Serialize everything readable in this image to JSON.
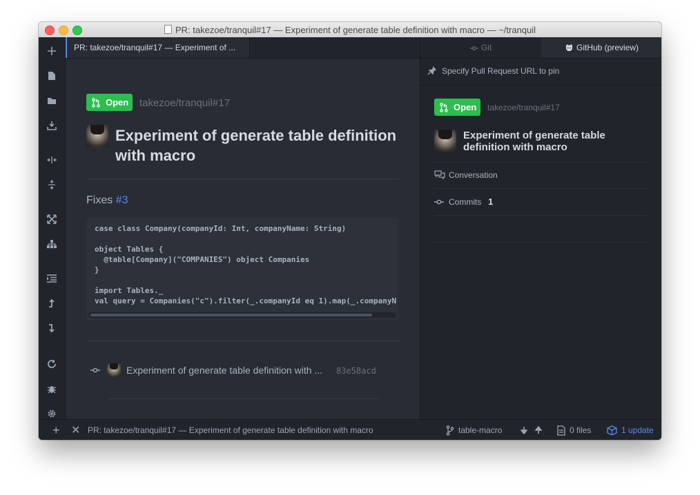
{
  "window": {
    "title": "PR: takezoe/tranquil#17 — Experiment of generate table definition with macro — ~/tranquil"
  },
  "tab": {
    "title": "PR: takezoe/tranquil#17 — Experiment of ..."
  },
  "toolbar": {
    "items": [
      "add-icon",
      "new-file-icon",
      "folder-icon",
      "save-icon",
      "split-horizontal-icon",
      "split-vertical-icon",
      "fullscreen-icon",
      "tree-icon",
      "indent-icon",
      "move-up-icon",
      "move-down-icon",
      "reload-icon",
      "bug-icon",
      "settings-icon"
    ]
  },
  "pr": {
    "state": "Open",
    "repo_ref": "takezoe/tranquil#17",
    "title_line1": "Experiment of generate table definition",
    "title_line2": "with macro",
    "fixes_label": "Fixes",
    "fixes_link": "#3",
    "code_block": "case class Company(companyId: Int, companyName: String)\n\nobject Tables {\n  @table[Company](\"COMPANIES\") object Companies\n}\n\nimport Tables._\nval query = Companies(\"c\").filter(_.companyId eq 1).map(_.companyN",
    "commit_message": "Experiment of generate table definition with ...",
    "commit_sha": "83e58acd"
  },
  "right_pane": {
    "tabs": {
      "git": "Git",
      "github": "GitHub (preview)"
    },
    "pin_label": "Specify Pull Request URL to pin",
    "state": "Open",
    "repo_ref": "takezoe/tranquil#17",
    "title_line1": "Experiment of generate table",
    "title_line2": "definition with macro",
    "conversation_label": "Conversation",
    "commits_label": "Commits",
    "commits_count": "1"
  },
  "statusbar": {
    "path": "PR: takezoe/tranquil#17 — Experiment of generate table definition with macro",
    "branch": "table-macro",
    "files": "0 files",
    "update": "1 update"
  },
  "colors": {
    "accent": "#568af2",
    "open_green": "#2cbe4e",
    "background": "#282c34"
  }
}
